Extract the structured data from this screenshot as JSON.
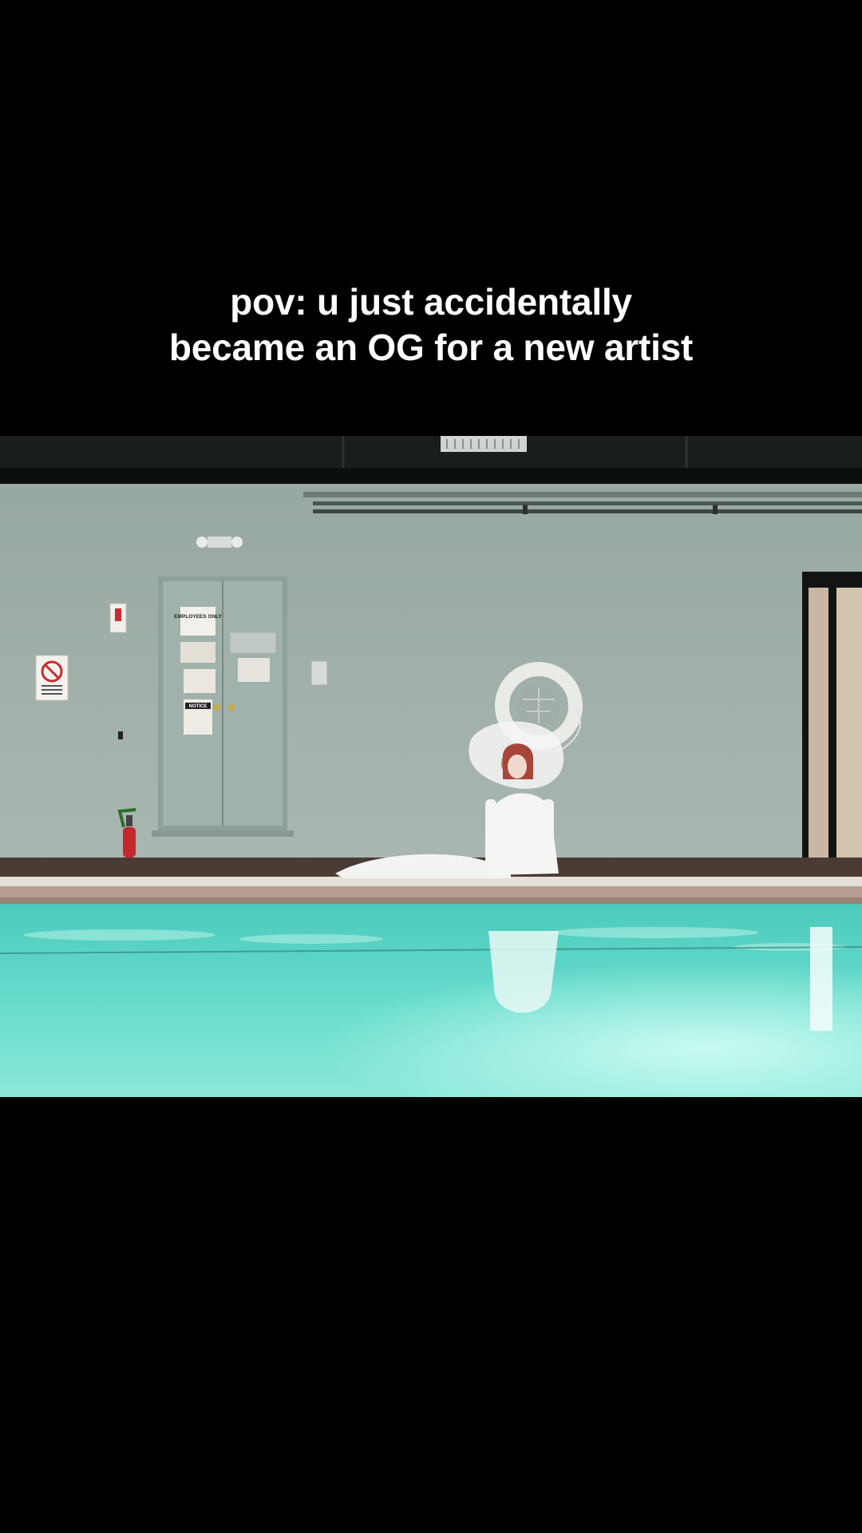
{
  "caption": {
    "line1": "pov: u just accidentally",
    "line2": "became an OG for a new artist"
  },
  "scene": {
    "door_sign": "EMPLOYEES ONLY",
    "notice_sign": "NOTICE"
  },
  "colors": {
    "background": "#000000",
    "wall": "#a6b5ae",
    "pool_water": "#5fd6c8",
    "caption_text": "#ffffff"
  }
}
